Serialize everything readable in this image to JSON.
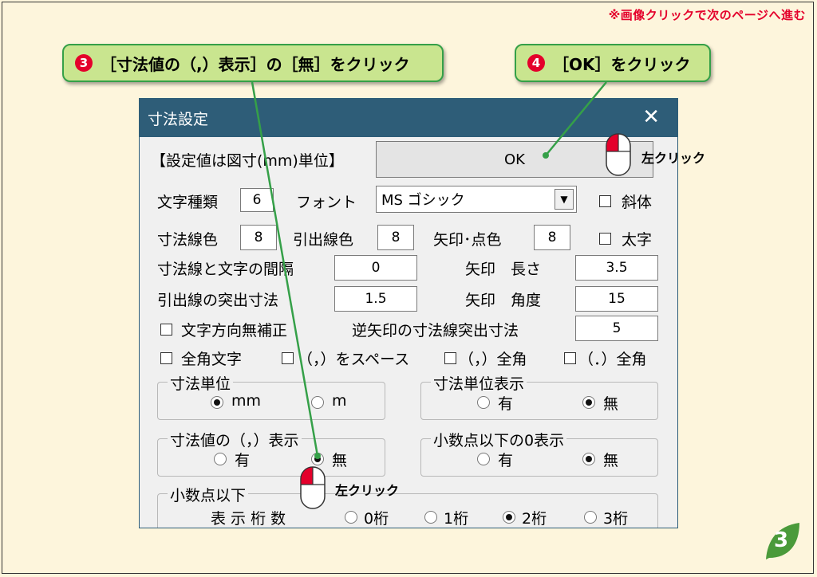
{
  "notice": "※画像クリックで次のページへ進む",
  "callouts": {
    "step3_num": "3",
    "step3_text": "［寸法値の（,）表示］の［無］をクリック",
    "step4_num": "4",
    "step4_text": "［OK］をクリック"
  },
  "dialog": {
    "title": "寸法設定",
    "close": "✕",
    "unit_note": "【設定値は図寸(mm)単位】",
    "ok_label": "OK",
    "char_type_label": "文字種類",
    "char_type_value": "6",
    "font_label": "フォント",
    "font_value": "MS ゴシック",
    "italic_label": "斜体",
    "dim_line_color_label": "寸法線色",
    "dim_line_color_value": "8",
    "leader_color_label": "引出線色",
    "leader_color_value": "8",
    "arrow_color_label": "矢印･点色",
    "arrow_color_value": "8",
    "bold_label": "太字",
    "gap_label": "寸法線と文字の間隔",
    "gap_value": "0",
    "arrow_length_label": "矢印　長さ",
    "arrow_length_value": "3.5",
    "leader_extend_label": "引出線の突出寸法",
    "leader_extend_value": "1.5",
    "arrow_angle_label": "矢印　角度",
    "arrow_angle_value": "15",
    "no_text_dir_label": "文字方向無補正",
    "reverse_arrow_label": "逆矢印の寸法線突出寸法",
    "reverse_arrow_value": "5",
    "fullwidth_text_label": "全角文字",
    "comma_space_label": "（，）をスペース",
    "comma_full_label": "（，）全角",
    "period_full_label": "（．）全角",
    "dim_unit_legend": "寸法単位",
    "dim_unit_mm": "mm",
    "dim_unit_m": "m",
    "dim_unit_display_legend": "寸法単位表示",
    "dim_unit_display_yes": "有",
    "dim_unit_display_no": "無",
    "comma_display_legend": "寸法値の（，）表示",
    "comma_display_yes": "有",
    "comma_display_no": "無",
    "zero_display_legend": "小数点以下の0表示",
    "zero_display_yes": "有",
    "zero_display_no": "無",
    "decimal_legend": "小数点以下",
    "decimal_digits_label": "表 示 桁 数",
    "decimal_0": "0桁",
    "decimal_1": "1桁",
    "decimal_2": "2桁",
    "decimal_3": "3桁"
  },
  "mouse": {
    "left_click_1": "左クリック",
    "left_click_2": "左クリック"
  },
  "page_number": "3",
  "colors": {
    "accent_red": "#e4002b",
    "callout_fill": "#c9e58f",
    "callout_border": "#35a048",
    "titlebar": "#2e5d78"
  }
}
